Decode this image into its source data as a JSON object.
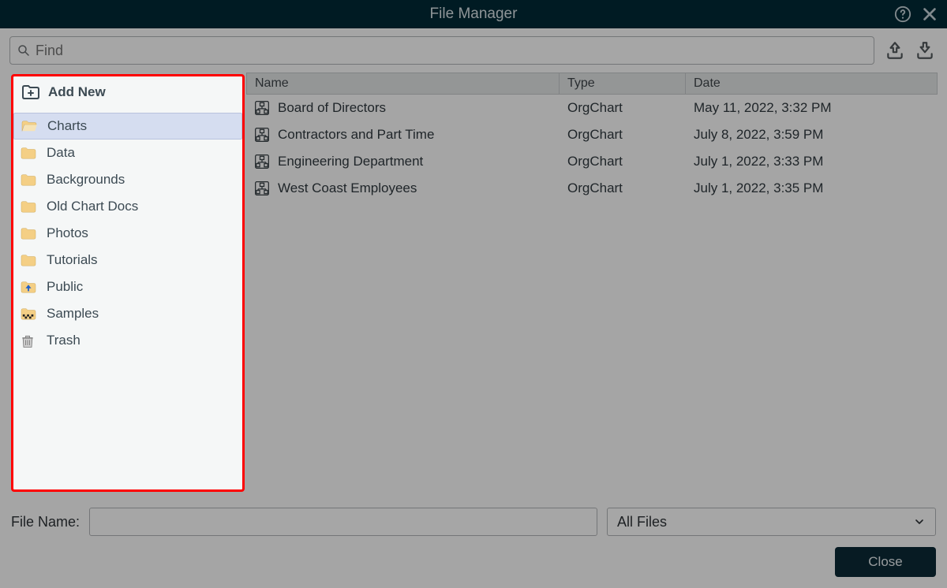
{
  "window": {
    "title": "File Manager"
  },
  "search": {
    "placeholder": "Find",
    "value": ""
  },
  "sidebar": {
    "add_new_label": "Add New",
    "items": [
      {
        "label": "Charts",
        "icon": "folder-open",
        "selected": true
      },
      {
        "label": "Data",
        "icon": "folder",
        "selected": false
      },
      {
        "label": "Backgrounds",
        "icon": "folder",
        "selected": false
      },
      {
        "label": "Old Chart Docs",
        "icon": "folder",
        "selected": false
      },
      {
        "label": "Photos",
        "icon": "folder",
        "selected": false
      },
      {
        "label": "Tutorials",
        "icon": "folder",
        "selected": false
      },
      {
        "label": "Public",
        "icon": "folder-up",
        "selected": false
      },
      {
        "label": "Samples",
        "icon": "folder-pattern",
        "selected": false
      },
      {
        "label": "Trash",
        "icon": "trash",
        "selected": false
      }
    ]
  },
  "columns": {
    "name": "Name",
    "type": "Type",
    "date": "Date"
  },
  "files": [
    {
      "name": "Board of Directors",
      "type": "OrgChart",
      "date": "May 11, 2022, 3:32 PM"
    },
    {
      "name": "Contractors and Part Time",
      "type": "OrgChart",
      "date": "July 8, 2022, 3:59 PM"
    },
    {
      "name": "Engineering Department",
      "type": "OrgChart",
      "date": "July 1, 2022, 3:33 PM"
    },
    {
      "name": "West Coast Employees",
      "type": "OrgChart",
      "date": "July 1, 2022, 3:35 PM"
    }
  ],
  "footer": {
    "filename_label": "File Name:",
    "filename_value": "",
    "filter_label": "All Files",
    "close_label": "Close"
  }
}
